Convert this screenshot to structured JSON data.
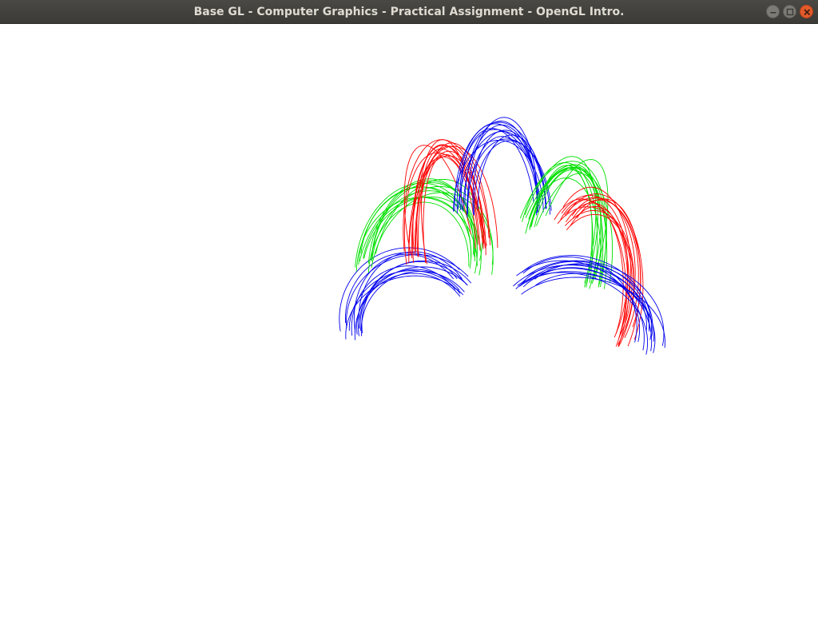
{
  "window": {
    "title": "Base GL - Computer Graphics - Practical Assignment - OpenGL Intro.",
    "controls": {
      "minimize_icon": "minimize-icon",
      "maximize_icon": "maximize-icon",
      "close_icon": "close-icon"
    }
  },
  "viewport": {
    "background": "#ffffff",
    "stroke_colors": {
      "red": "#ff0000",
      "green": "#00e000",
      "blue": "#0000ee"
    }
  }
}
